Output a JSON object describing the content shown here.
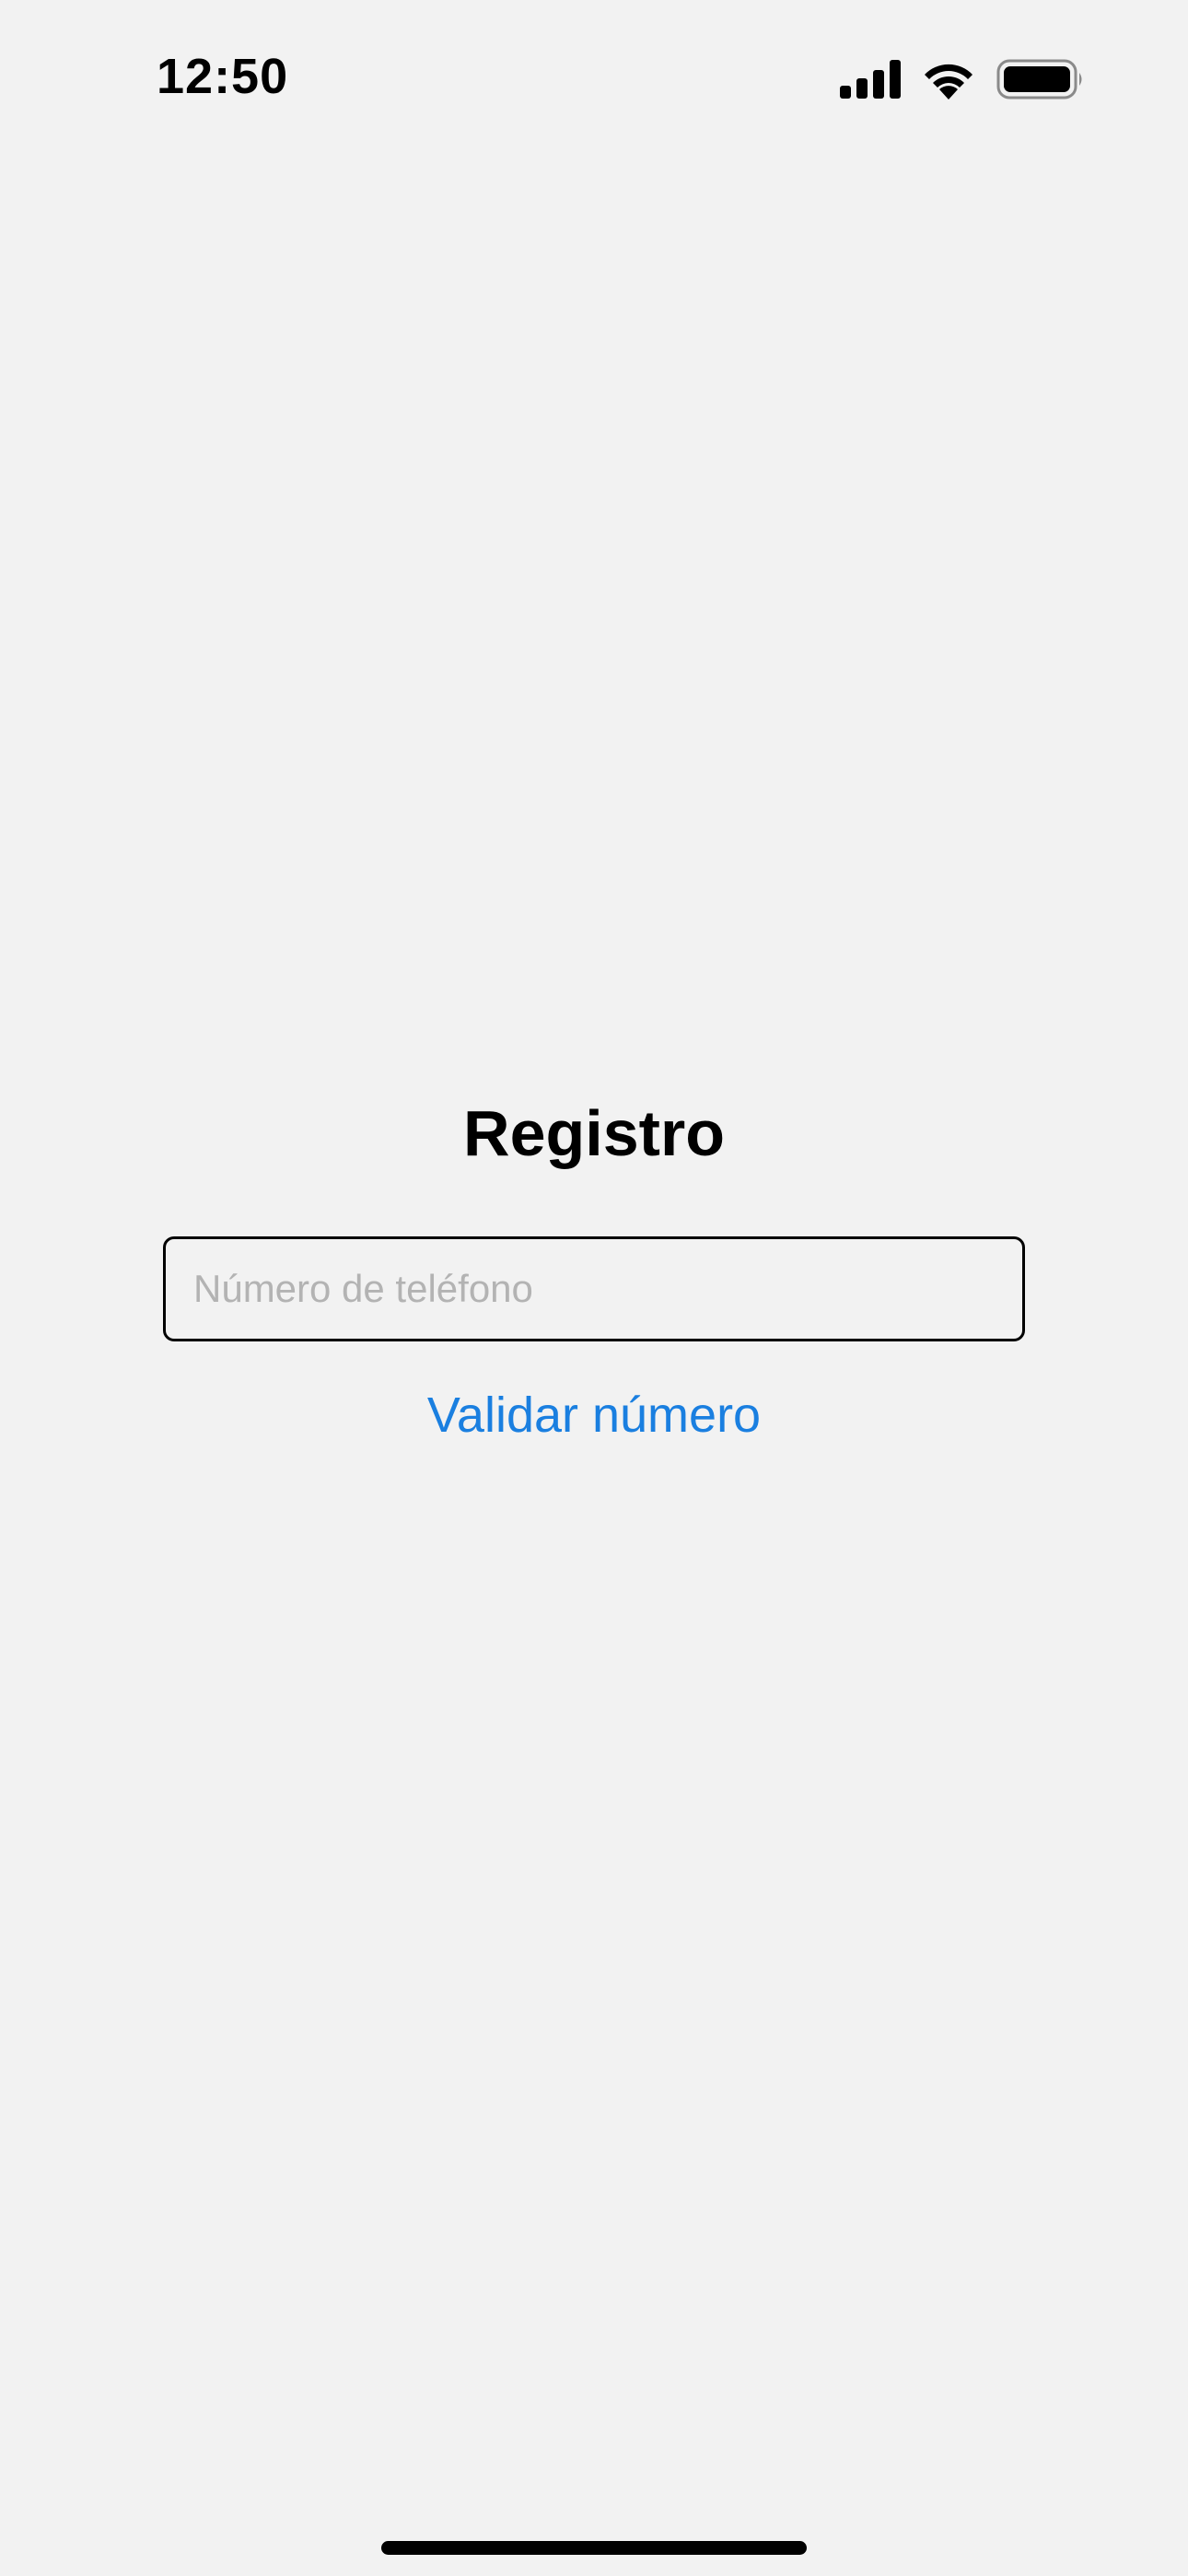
{
  "status_bar": {
    "time": "12:50",
    "icons": [
      "cellular-signal-icon",
      "wifi-icon",
      "battery-icon"
    ]
  },
  "registration": {
    "title": "Registro",
    "phone_field": {
      "placeholder": "Número de teléfono",
      "value": ""
    },
    "validate_label": "Validar número"
  },
  "colors": {
    "background": "#f2f2f2",
    "accent": "#1a7fe0",
    "text": "#000000",
    "placeholder": "#b3b3b3"
  }
}
